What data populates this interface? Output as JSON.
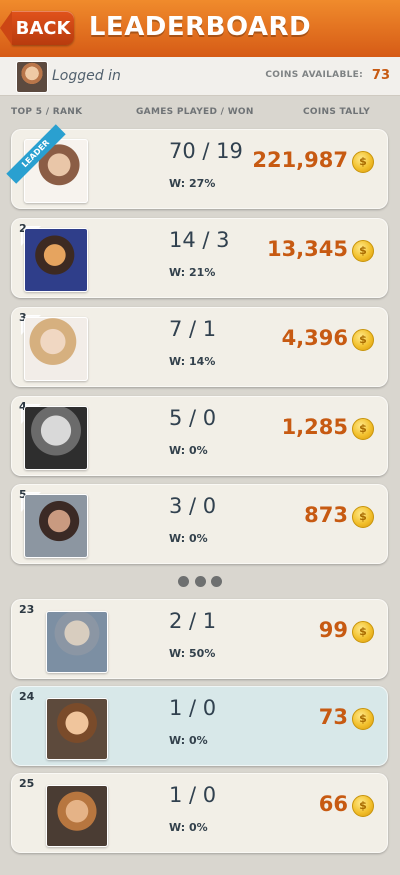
{
  "header": {
    "back_label": "BACK",
    "title": "LEADERBOARD"
  },
  "user": {
    "logged_text": "Logged in",
    "coins_label": "COINS AVAILABLE:",
    "coins_value": "73"
  },
  "columns": {
    "rank": "TOP 5 / RANK",
    "games": "GAMES PLAYED / WON",
    "coins": "COINS TALLY"
  },
  "leaderboard": {
    "leader_badge": "LEADER",
    "rows": [
      {
        "rank": "",
        "games_won": "70 / 19",
        "win_pct": "W: 27%",
        "coins": "221,987"
      },
      {
        "rank": "2",
        "games_won": "14 / 3",
        "win_pct": "W: 21%",
        "coins": "13,345"
      },
      {
        "rank": "3",
        "games_won": "7 / 1",
        "win_pct": "W: 14%",
        "coins": "4,396"
      },
      {
        "rank": "4",
        "games_won": "5 / 0",
        "win_pct": "W: 0%",
        "coins": "1,285"
      },
      {
        "rank": "5",
        "games_won": "3 / 0",
        "win_pct": "W: 0%",
        "coins": "873"
      },
      {
        "rank": "23",
        "games_won": "2 / 1",
        "win_pct": "W: 50%",
        "coins": "99"
      },
      {
        "rank": "24",
        "games_won": "1 / 0",
        "win_pct": "W: 0%",
        "coins": "73"
      },
      {
        "rank": "25",
        "games_won": "1 / 0",
        "win_pct": "W: 0%",
        "coins": "66"
      }
    ]
  },
  "icons": {
    "coin": "coin-icon",
    "more": "pagination-dots-icon"
  },
  "colors": {
    "header_orange": "#e06b20",
    "coins_orange": "#c75a12",
    "card_bg": "#f2efe7",
    "current_user_bg": "#d8e8e9",
    "leader_ribbon": "#2aa0d0"
  },
  "coin_symbol": "$"
}
